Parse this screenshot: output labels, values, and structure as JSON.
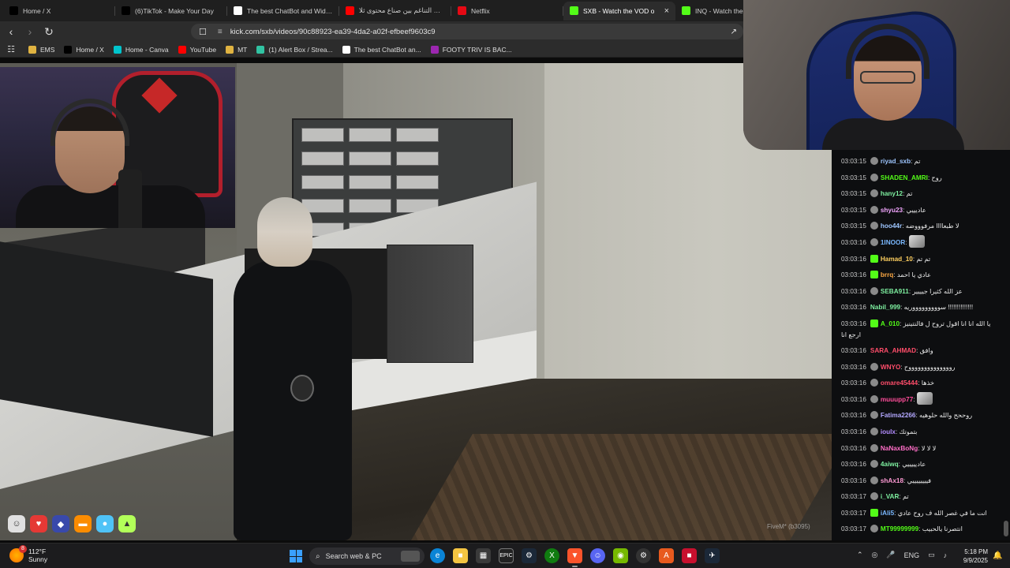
{
  "browser": {
    "tabs": [
      {
        "label": "Home / X",
        "icon": "x-logo-icon",
        "color": "#000000"
      },
      {
        "label": "(6)TikTok - Make Your Day",
        "icon": "tiktok-icon",
        "color": "#000000"
      },
      {
        "label": "The best ChatBot and Widgets",
        "icon": "chatbot-icon",
        "color": "#ffffff"
      },
      {
        "label": "تحدي التناغم بين صناع محتوى ثلا",
        "icon": "youtube-icon",
        "color": "#ff0000"
      },
      {
        "label": "Netflix",
        "icon": "netflix-icon",
        "color": "#e50914"
      },
      {
        "label": "SXB - Watch the VOD o",
        "icon": "kick-icon",
        "color": "#53fc18",
        "active": true
      },
      {
        "label": "INQ - Watch the VOD",
        "icon": "kick-icon",
        "color": "#53fc18"
      }
    ],
    "url": "kick.com/sxb/videos/90c88923-ea39-4da2-a02f-efbeef9603c9",
    "bookmarks": [
      {
        "label": "EMS",
        "icon": "folder-icon",
        "color": "#e0b341"
      },
      {
        "label": "Home / X",
        "icon": "x-logo-icon",
        "color": "#000000"
      },
      {
        "label": "Home - Canva",
        "icon": "canva-icon",
        "color": "#00c4cc"
      },
      {
        "label": "YouTube",
        "icon": "youtube-icon",
        "color": "#ff0000"
      },
      {
        "label": "MT",
        "icon": "folder-icon",
        "color": "#e0b341"
      },
      {
        "label": "(1) Alert Box / Strea...",
        "icon": "streamlabs-icon",
        "color": "#31c3a2"
      },
      {
        "label": "The best ChatBot an...",
        "icon": "chatbot-icon",
        "color": "#ffffff"
      },
      {
        "label": "FOOTY TRIV IS BAC...",
        "icon": "footy-icon",
        "color": "#9c27b0"
      }
    ]
  },
  "stream": {
    "watermark": "FiveM* (b3095)"
  },
  "chat": {
    "messages": [
      {
        "time": "03:03:15",
        "user": "riyad_sxb",
        "color": "#9ec6ff",
        "text": "تم",
        "badge": "gray"
      },
      {
        "time": "03:03:15",
        "user": "SHADEN_AMRI",
        "color": "#53fc18",
        "text": "روح",
        "badge": "gray"
      },
      {
        "time": "03:03:15",
        "user": "hany12",
        "color": "#7ef0a0",
        "text": "تم",
        "badge": "gray"
      },
      {
        "time": "03:03:15",
        "user": "shyu23",
        "color": "#f3a6ff",
        "text": "عاديييي",
        "badge": "gray"
      },
      {
        "time": "03:03:15",
        "user": "hoo44r",
        "color": "#9ec6ff",
        "text": "لا طبعاااا مرفوووضه",
        "badge": "gray"
      },
      {
        "time": "03:03:16",
        "user": "1INOOR",
        "color": "#7ab8ff",
        "text": "",
        "badge": "gray",
        "emote": true
      },
      {
        "time": "03:03:16",
        "user": "Hamad_10",
        "color": "#ffd060",
        "text": "تم تم",
        "badge": "green"
      },
      {
        "time": "03:03:16",
        "user": "brrq",
        "color": "#ffaa44",
        "text": "عادي يا احمد",
        "badge": "green"
      },
      {
        "time": "03:03:16",
        "user": "SEBA911",
        "color": "#7ef0a0",
        "text": "عز الله كثيرا جيييير",
        "badge": "gray"
      },
      {
        "time": "03:03:16",
        "user": "Nabil_999",
        "color": "#7ef0a0",
        "text": "سوووووووووريه !!!!!!!!!!!!!!",
        "badge": ""
      },
      {
        "time": "03:03:16",
        "user": "A_010",
        "color": "#53fc18",
        "text": "يا الله انا انا اقول تروح ل فالنتينيز ارجع انا",
        "badge": "green",
        "tall": true
      },
      {
        "time": "03:03:16",
        "user": "SARA_AHMAD",
        "color": "#ff4d6a",
        "text": "وافق",
        "badge": ""
      },
      {
        "time": "03:03:16",
        "user": "WNYO",
        "color": "#ff4d6a",
        "text": "رووووووووووووووح",
        "badge": "gray"
      },
      {
        "time": "03:03:16",
        "user": "omare45444",
        "color": "#ff4d6a",
        "text": "خذها",
        "badge": "gray"
      },
      {
        "time": "03:03:16",
        "user": "muuupp77",
        "color": "#ff4d9a",
        "text": "",
        "badge": "gray",
        "emote": true
      },
      {
        "time": "03:03:16",
        "user": "Fatima2266",
        "color": "#b3a8ff",
        "text": "روححح والله حلوهيه",
        "badge": "gray"
      },
      {
        "time": "03:03:16",
        "user": "ioulx",
        "color": "#b38cff",
        "text": "بتموتك",
        "badge": "gray"
      },
      {
        "time": "03:03:16",
        "user": "NaNaxBoNg",
        "color": "#ff6ec7",
        "text": "لا لا لا",
        "badge": "gray"
      },
      {
        "time": "03:03:16",
        "user": "4aiwq",
        "color": "#7ef0a0",
        "text": "عاديييييي",
        "badge": "gray"
      },
      {
        "time": "03:03:16",
        "user": "shAx18",
        "color": "#ff9ad5",
        "text": "فييييييييي",
        "badge": "gray"
      },
      {
        "time": "03:03:17",
        "user": "i_VAR",
        "color": "#7ef0a0",
        "text": "تم",
        "badge": "gray"
      },
      {
        "time": "03:03:17",
        "user": "iAli5",
        "color": "#7ab8ff",
        "text": "انت ما في غصر الله ف روح عادي",
        "badge": "green"
      },
      {
        "time": "03:03:17",
        "user": "MT99999999",
        "color": "#53fc18",
        "text": "انتصرنا يالحبيب",
        "badge": "gray"
      }
    ]
  },
  "taskbar": {
    "weather": {
      "temp": "112°F",
      "cond": "Sunny",
      "badge": "8"
    },
    "search_placeholder": "Search web & PC",
    "lang": "ENG",
    "time": "5:18 PM",
    "date": "9/9/2025"
  }
}
